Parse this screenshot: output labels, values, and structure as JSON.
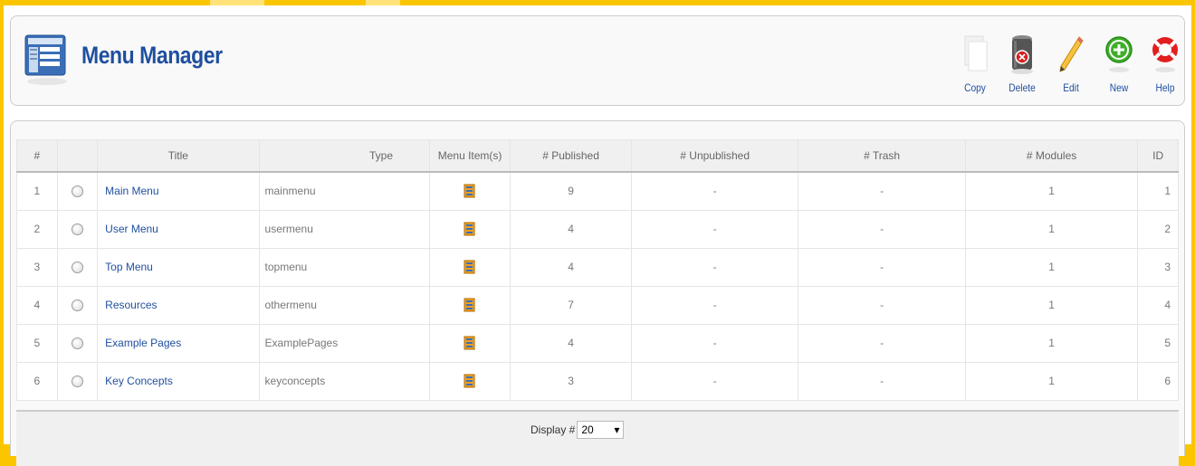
{
  "header": {
    "title": "Menu Manager"
  },
  "toolbar": {
    "copy": "Copy",
    "delete": "Delete",
    "edit": "Edit",
    "new": "New",
    "help": "Help"
  },
  "table": {
    "columns": [
      "#",
      "",
      "Title",
      "Type",
      "Menu Item(s)",
      "# Published",
      "# Unpublished",
      "# Trash",
      "# Modules",
      "ID"
    ],
    "rows": [
      {
        "num": "1",
        "title": "Main Menu",
        "type": "mainmenu",
        "published": "9",
        "unpublished": "-",
        "trash": "-",
        "modules": "1",
        "id": "1"
      },
      {
        "num": "2",
        "title": "User Menu",
        "type": "usermenu",
        "published": "4",
        "unpublished": "-",
        "trash": "-",
        "modules": "1",
        "id": "2"
      },
      {
        "num": "3",
        "title": "Top Menu",
        "type": "topmenu",
        "published": "4",
        "unpublished": "-",
        "trash": "-",
        "modules": "1",
        "id": "3"
      },
      {
        "num": "4",
        "title": "Resources",
        "type": "othermenu",
        "published": "7",
        "unpublished": "-",
        "trash": "-",
        "modules": "1",
        "id": "4"
      },
      {
        "num": "5",
        "title": "Example Pages",
        "type": "ExamplePages",
        "published": "4",
        "unpublished": "-",
        "trash": "-",
        "modules": "1",
        "id": "5"
      },
      {
        "num": "6",
        "title": "Key Concepts",
        "type": "keyconcepts",
        "published": "3",
        "unpublished": "-",
        "trash": "-",
        "modules": "1",
        "id": "6"
      }
    ]
  },
  "footer": {
    "display_label": "Display #",
    "display_value": "20"
  },
  "icons": {
    "header": "menu-manager-icon",
    "copy": "copy-icon",
    "delete": "trash-can-icon",
    "edit": "pencil-icon",
    "new": "plus-circle-icon",
    "help": "lifebuoy-icon",
    "menu_items": "menu-items-icon"
  }
}
